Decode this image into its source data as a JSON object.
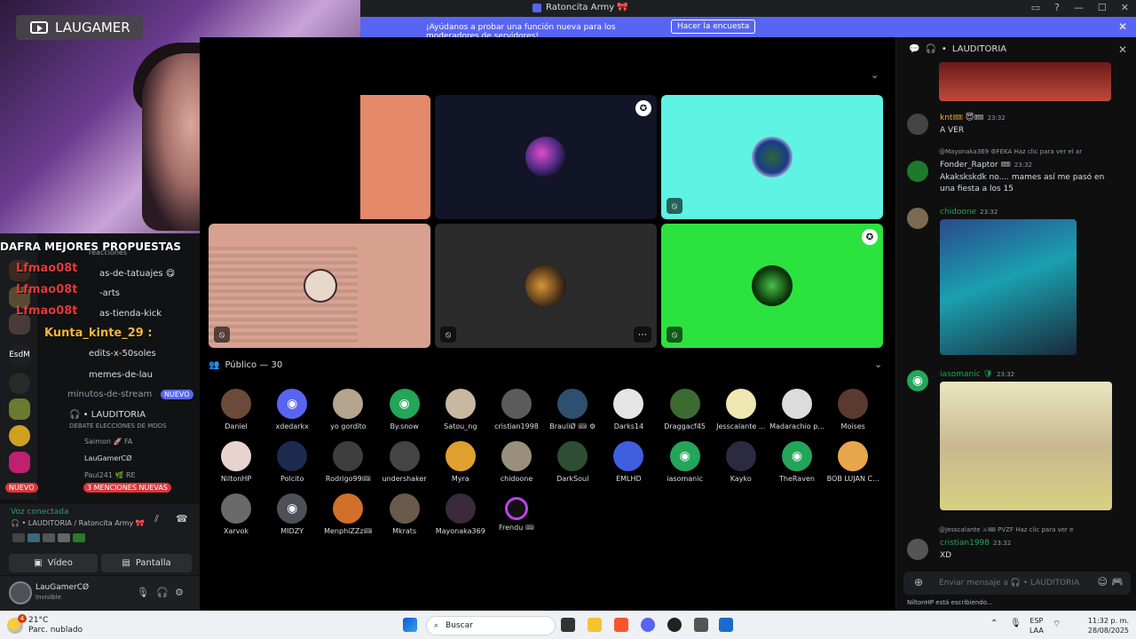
{
  "window": {
    "title": "Ratoncita Army 🎀",
    "controls": [
      "▭",
      "?",
      "—",
      "☐",
      "✕"
    ]
  },
  "banner": {
    "message": "¡Ayúdanos a probar una función nueva para los moderadores de servidores!",
    "button": "Hacer la encuesta"
  },
  "webcam": {
    "badge": "LAUGAMER"
  },
  "overlay": {
    "title": "DAFRA MEJORES PROPUESTAS",
    "chatters": [
      "Lfmao08t",
      "Lfmao08t",
      "Lfmao08t"
    ],
    "highlight": "Kunta_kinte_29 :",
    "reacciones_label": "reacciones"
  },
  "sidebar": {
    "channels": [
      {
        "label": "as-de-tatuajes 😋"
      },
      {
        "label": "-arts"
      },
      {
        "label": "as-tienda-kick"
      },
      {
        "label": "edits-x-50soles"
      },
      {
        "label": "memes-de-lau"
      },
      {
        "label": "minutos-de-stream"
      }
    ],
    "nuevo_badge": "NUEVO",
    "voice_channel": "LAUDITORIA",
    "voice_topic": "DEBATE ELECCIONES DE MODS",
    "voice_members": [
      {
        "name": "Saimon",
        "tag": "FA"
      },
      {
        "name": "LauGamerCØ",
        "tag": ""
      },
      {
        "name": "Paul241",
        "tag": "RE"
      }
    ],
    "server_badge": "EsdM",
    "new_pill": "NUEVO",
    "mentions_pill": "3 MENCIONES NUEVAS"
  },
  "voice_status": {
    "title": "Voz conectada",
    "location": "LAUDITORIA / Ratoncita Army 🎀",
    "video_button": "Vídeo",
    "screen_button": "Pantalla"
  },
  "user_panel": {
    "name": "LauGamerCØ",
    "status": "Invisible"
  },
  "stage": {
    "public_label": "Público — 30",
    "audience": [
      {
        "name": "Daniel",
        "color": "#6b4a3a"
      },
      {
        "name": "xdedarkx",
        "color": "discord"
      },
      {
        "name": "yo gordito",
        "color": "#b5a48e"
      },
      {
        "name": "By.snow",
        "color": "#23a55a"
      },
      {
        "name": "Satou_ng",
        "color": "#c9b7a2"
      },
      {
        "name": "cristian1998",
        "color": "#5b5b5b"
      },
      {
        "name": "BrauliØ 🎟 ⚙",
        "color": "#2f4f6f"
      },
      {
        "name": "Darks14",
        "color": "#e5e5e5"
      },
      {
        "name": "Draggacf45",
        "color": "#3c6b32"
      },
      {
        "name": "Jesscalante ...",
        "color": "#efe7b0"
      },
      {
        "name": "Madarachio p...",
        "color": "#dcdcdc"
      },
      {
        "name": "Moises",
        "color": "#5a3a2e"
      },
      {
        "name": "NiltonHP",
        "color": "#e8d3cf"
      },
      {
        "name": "Polcito",
        "color": "#1d2a4f"
      },
      {
        "name": "Rodrigo99🎟",
        "color": "#3e3e3e"
      },
      {
        "name": "undershaker",
        "color": "#444"
      },
      {
        "name": "Myra",
        "color": "#e0a030"
      },
      {
        "name": "chidoone",
        "color": "#9a8f7c"
      },
      {
        "name": "DarkSoul",
        "color": "#2f4d32"
      },
      {
        "name": "EMLHD",
        "color": "#3f5ee0"
      },
      {
        "name": "iasomanic",
        "color": "#23a55a"
      },
      {
        "name": "Kayko",
        "color": "#2a2a40"
      },
      {
        "name": "TheRaven",
        "color": "#23a55a"
      },
      {
        "name": "BOB LUJAN C...",
        "color": "#e8a64a"
      },
      {
        "name": "Xarvok",
        "color": "#6a6a6a"
      },
      {
        "name": "MIDZY",
        "color": "#4e5058"
      },
      {
        "name": "MenphiZZz🎟",
        "color": "#d0702a"
      },
      {
        "name": "Mkrats",
        "color": "#6a5a4a"
      },
      {
        "name": "Mayonaka369",
        "color": "#3a2a3a"
      },
      {
        "name": "Frendu 🎟",
        "color": "ring"
      }
    ]
  },
  "chat": {
    "header": "LAUDITORIA",
    "messages": [
      {
        "user": "knt🎟",
        "user_color": "#f0b232",
        "badges": "😇🎟",
        "time": "23:32",
        "text": "A VER",
        "pfp": "#444"
      },
      {
        "reply": "@Mayonaka369 ⚙FEKA  Haz clic para ver el ar",
        "user": "Fonder_Raptor 🎟",
        "user_color": "#dbdee1",
        "time": "23:32",
        "text": "Akakskskdk no.... mames así me pasó en una fiesta a los 15",
        "pfp": "#1e7a2a"
      },
      {
        "user": "chidoone",
        "user_color": "#23a55a",
        "time": "23:32",
        "text": "",
        "pfp": "#7a6a50"
      },
      {
        "user": "iasomanic 🛡",
        "user_color": "#23a55a",
        "time": "23:32",
        "text": "",
        "pfp": "#23a55a"
      },
      {
        "reply": "@Jesscalante ⚔🎟 PVZF  Haz clic para ver e",
        "user": "cristian1998",
        "user_color": "#23a55a",
        "time": "23:32",
        "text": "XD",
        "pfp": "#555"
      }
    ],
    "input_placeholder": "Enviar mensaje a  🎧 • LAUDITORIA",
    "typing": "NiltonHP está escribiendo..."
  },
  "taskbar": {
    "weather_temp": "21°C",
    "weather_desc": "Parc. nublado",
    "weather_alert": "4",
    "search": "Buscar",
    "lang_top": "ESP",
    "lang_bottom": "LAA",
    "time": "11:32 p. m.",
    "date": "28/08/2025"
  }
}
